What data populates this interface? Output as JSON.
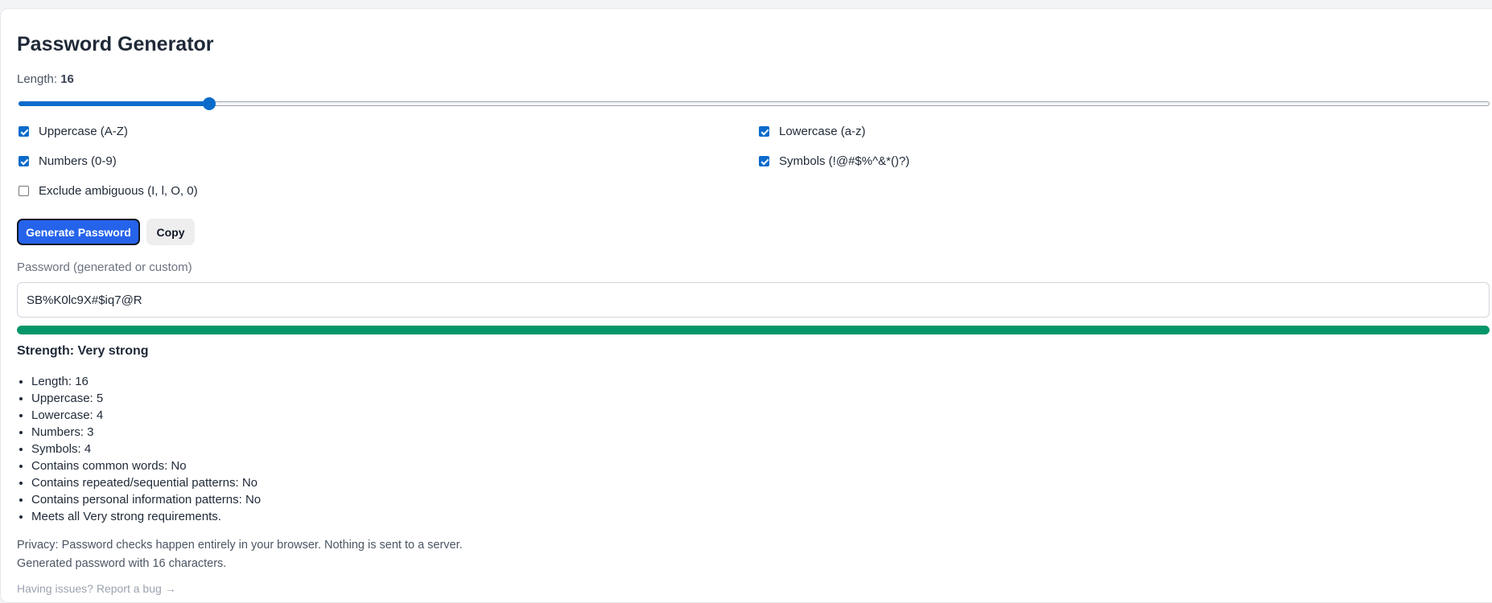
{
  "title": "Password Generator",
  "length": {
    "label": "Length:",
    "value": "16",
    "slider_min": 4,
    "slider_max": 99,
    "slider_value": 16
  },
  "options": {
    "uppercase": {
      "label": "Uppercase (A-Z)",
      "checked": true
    },
    "lowercase": {
      "label": "Lowercase (a-z)",
      "checked": true
    },
    "numbers": {
      "label": "Numbers (0-9)",
      "checked": true
    },
    "symbols": {
      "label": "Symbols (!@#$%^&*()?)",
      "checked": true
    },
    "exclude_ambiguous": {
      "label": "Exclude ambiguous (I, l, O, 0)",
      "checked": false
    }
  },
  "buttons": {
    "generate_label": "Generate Password",
    "copy_label": "Copy"
  },
  "password": {
    "label": "Password (generated or custom)",
    "value": "SB%K0lc9X#$iq7@R"
  },
  "strength": {
    "text": "Strength: Very strong",
    "fraction": 1.0,
    "color": "#059669"
  },
  "details": [
    "Length: 16",
    "Uppercase: 5",
    "Lowercase: 4",
    "Numbers: 3",
    "Symbols: 4",
    "Contains common words: No",
    "Contains repeated/sequential patterns: No",
    "Contains personal information patterns: No",
    "Meets all Very strong requirements."
  ],
  "privacy_note": "Privacy: Password checks happen entirely in your browser. Nothing is sent to a server.",
  "status_message": "Generated password with 16 characters.",
  "bug_link": "Having issues? Report a bug →",
  "colors": {
    "accent": "#0b6bcb",
    "primary_button": "#2563eb",
    "strength_bar": "#059669"
  }
}
